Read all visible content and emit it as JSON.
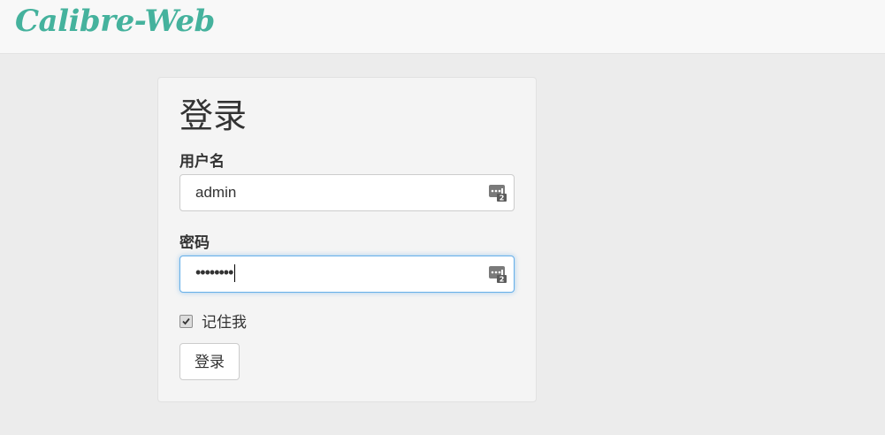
{
  "navbar": {
    "brand": "Calibre-Web",
    "brand_color": "#45b29d"
  },
  "login": {
    "title": "登录",
    "username_label": "用户名",
    "username_value": "admin",
    "password_label": "密码",
    "password_value": "••••••••",
    "remember_label": "记住我",
    "remember_checked": true,
    "submit_label": "登录",
    "field_icon": "password-manager-icon"
  }
}
